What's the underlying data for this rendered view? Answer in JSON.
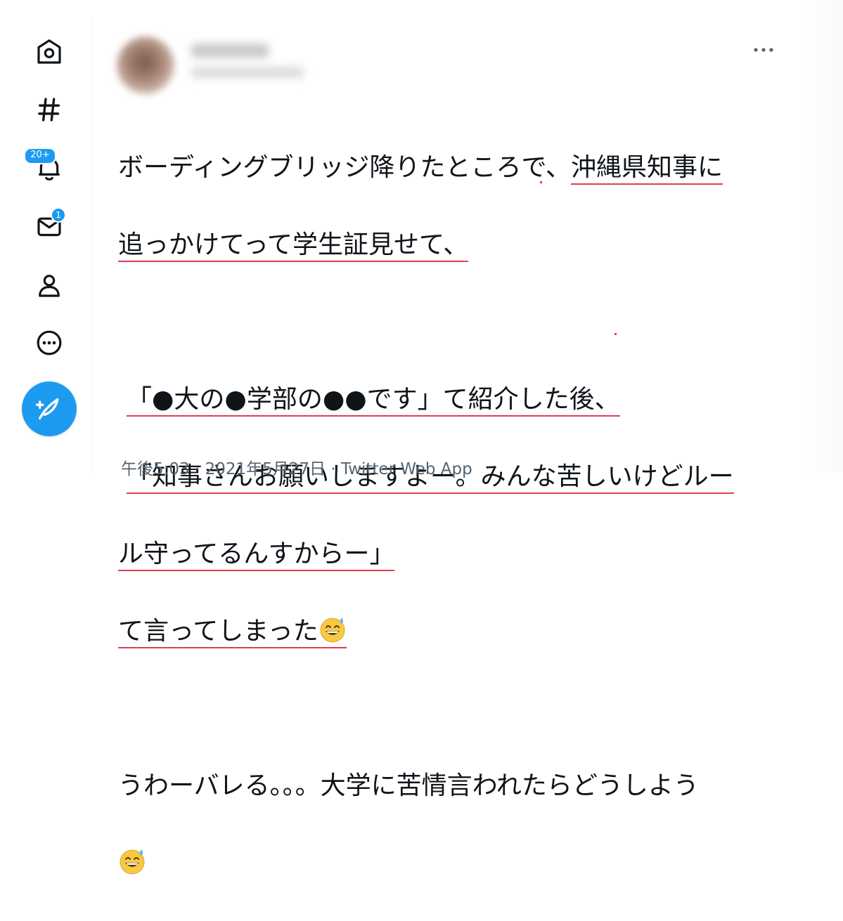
{
  "nav": {
    "notifications_badge": "20+",
    "messages_badge": "1"
  },
  "tweet": {
    "lines": [
      [
        "ボーディングブリッジ降りたところで、",
        "沖縄県知事に"
      ],
      [
        "追っかけてって学生証見せて、"
      ],
      [],
      [
        "「●大の●学部の●●です」て紹介した後、"
      ],
      [
        "「知事さんお願いしますよー。みんな苦しいけどルー"
      ],
      [
        "ル守ってるんすからー」"
      ],
      [
        "て言ってしまった"
      ],
      [],
      [
        "うわーバレる。。。大学に苦情言われたらどうしよう"
      ]
    ],
    "timestamp": "午後5:03 · 2021年5月27日 · Twitter Web App"
  },
  "colors": {
    "accent": "#1d9bf0",
    "underline": "#e23d4f",
    "text": "#0f1419",
    "muted": "#536471"
  },
  "icons": [
    "home-icon",
    "hashtag-icon",
    "bell-icon",
    "mail-icon",
    "profile-icon",
    "more-circle-icon",
    "compose-feather-icon",
    "more-horizontal-icon",
    "grinning-sweat-emoji"
  ]
}
